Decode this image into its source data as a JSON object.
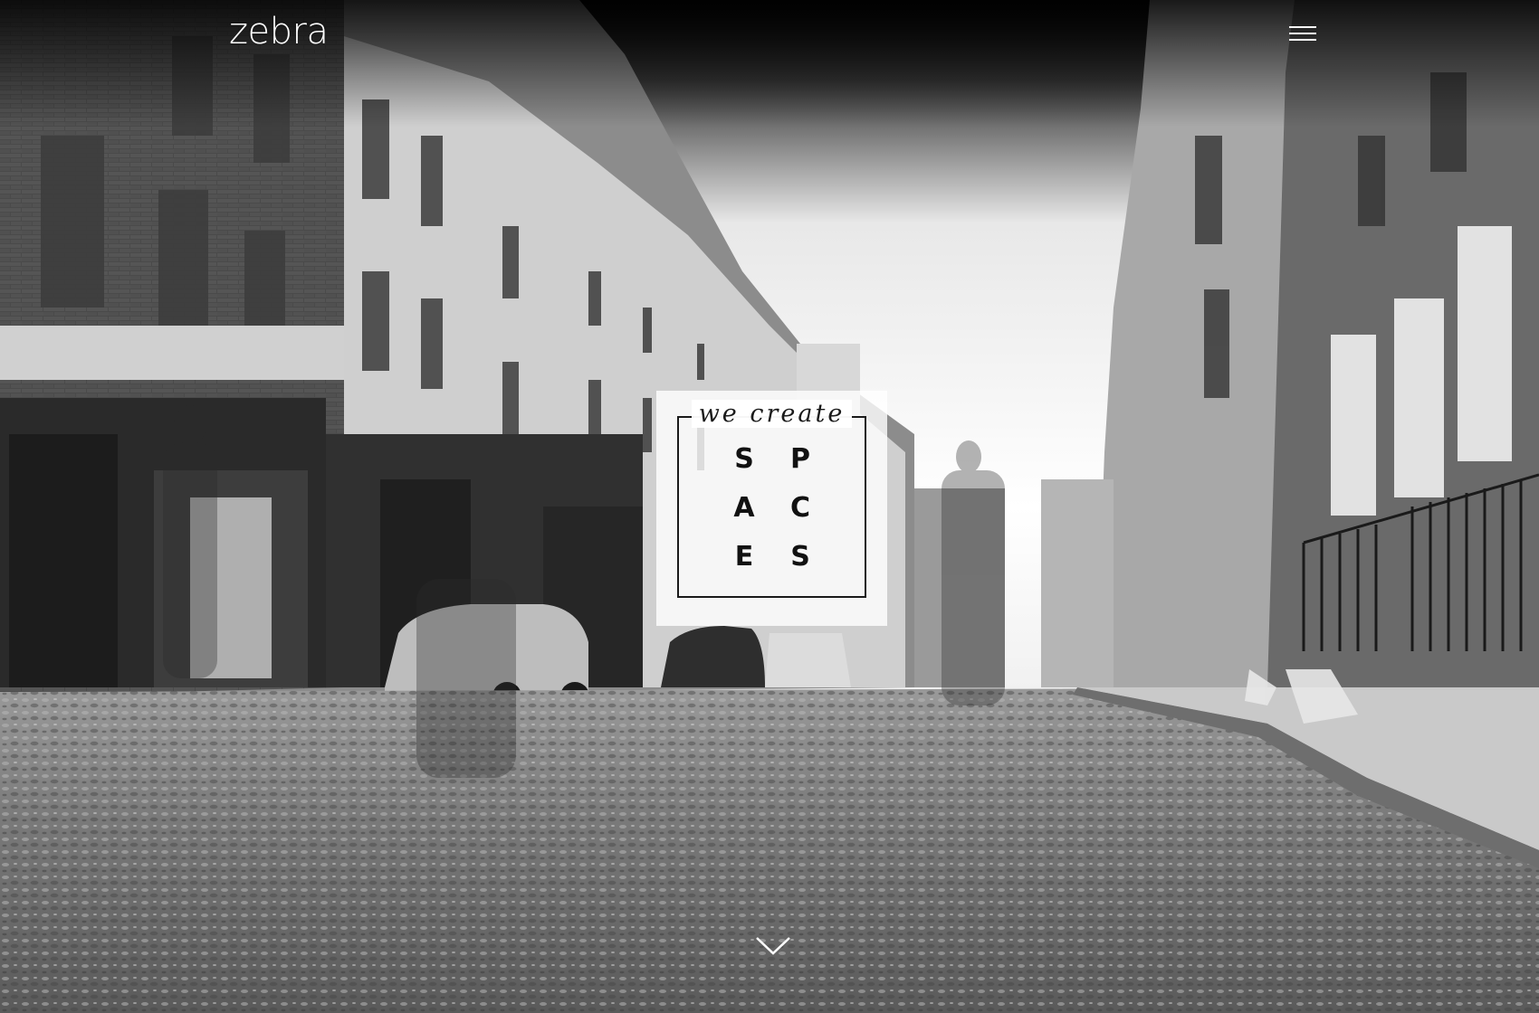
{
  "header": {
    "logo_text": "zebra",
    "menu_icon": "hamburger-menu-icon"
  },
  "hero": {
    "tagline_small": "we create",
    "tagline_letters": [
      "S",
      "P",
      "A",
      "C",
      "E",
      "S"
    ],
    "scroll_icon": "chevron-down-icon"
  },
  "colors": {
    "text_light": "#ffffff",
    "text_dark": "#1a1a1a",
    "panel": "#ffffff"
  }
}
